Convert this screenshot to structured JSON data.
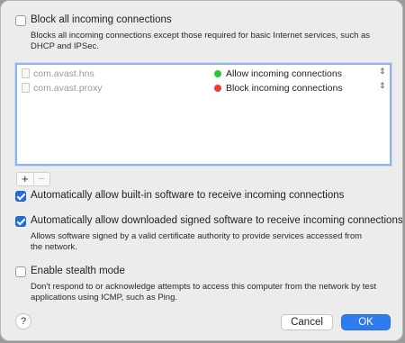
{
  "options": {
    "block_all": {
      "label": "Block all incoming connections",
      "description": "Blocks all incoming connections except those required for basic Internet services, such as DHCP and IPSec.",
      "checked": false
    },
    "auto_builtin": {
      "label": "Automatically allow built-in software to receive incoming connections",
      "checked": true
    },
    "auto_signed": {
      "label": "Automatically allow downloaded signed software to receive incoming connections",
      "description": "Allows software signed by a valid certificate authority to provide services accessed from the network.",
      "checked": true
    },
    "stealth": {
      "label": "Enable stealth mode",
      "description": "Don't respond to or acknowledge attempts to access this computer from the network by test applications using ICMP, such as Ping.",
      "checked": false
    }
  },
  "apps": [
    {
      "name": "com.avast.hns",
      "status": "Allow incoming connections",
      "status_color": "#32c23f"
    },
    {
      "name": "com.avast.proxy",
      "status": "Block incoming connections",
      "status_color": "#ee3b3b"
    }
  ],
  "list_controls": {
    "add": "+",
    "remove": "−"
  },
  "footer": {
    "help": "?",
    "cancel": "Cancel",
    "ok": "OK"
  },
  "icons": {
    "updown": "⇕",
    "stepper": "stepper-arrows-icon"
  },
  "colors": {
    "accent": "#2f7bf0",
    "allow": "#32c23f",
    "block": "#ee3b3b"
  }
}
